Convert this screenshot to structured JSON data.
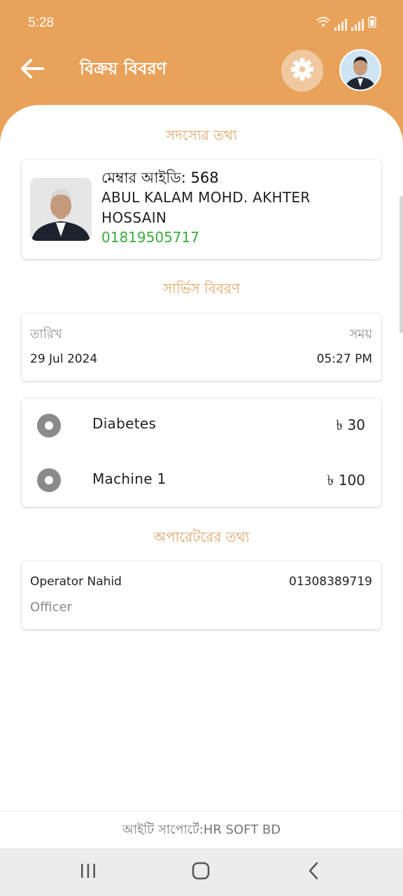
{
  "status_bar": {
    "time": "5:28"
  },
  "appbar": {
    "title": "বিক্রয় বিবরণ"
  },
  "member_section": {
    "title": "সদস্যের তথ্য",
    "member_id_label": "মেম্বার আইডি: 568",
    "name": "ABUL KALAM MOHD. AKHTER HOSSAIN",
    "phone": "01819505717"
  },
  "service_section": {
    "title": "সার্ভিস বিবরণ",
    "date_label": "তারিখ",
    "time_label": "সময়",
    "date_value": "29 Jul 2024",
    "time_value": "05:27 PM",
    "items": [
      {
        "name": "Diabetes",
        "price": "৳ 30"
      },
      {
        "name": "Machine 1",
        "price": "৳ 100"
      }
    ]
  },
  "operator_section": {
    "title": "অপারেটরের তথ্য",
    "name": "Operator Nahid",
    "phone": "01308389719",
    "role": "Officer"
  },
  "footer": {
    "text": "আইটি সাপোর্টে:HR SOFT BD"
  },
  "colors": {
    "primary": "#e9a25a",
    "accent_text": "#e2a060",
    "phone_green": "#3bab3f"
  }
}
